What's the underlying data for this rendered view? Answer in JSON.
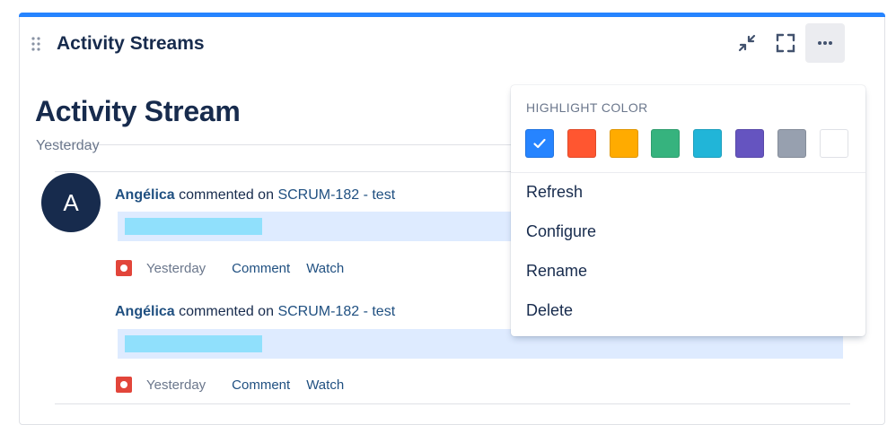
{
  "gadget": {
    "title": "Activity Streams",
    "accent_color": "#2684ff",
    "header_buttons": [
      {
        "name": "minimize",
        "icon": "minimize-icon"
      },
      {
        "name": "maximize",
        "icon": "maximize-icon"
      },
      {
        "name": "more",
        "icon": "more-icon"
      }
    ]
  },
  "stream": {
    "title": "Activity Stream",
    "day_label": "Yesterday",
    "avatar_initial": "A",
    "entries": [
      {
        "user": "Angélica",
        "action": "commented on",
        "issue": "SCRUM-182 - test",
        "time": "Yesterday",
        "comment_label": "Comment",
        "watch_label": "Watch"
      },
      {
        "user": "Angélica",
        "action": "commented on",
        "issue": "SCRUM-182 - test",
        "time": "Yesterday",
        "comment_label": "Comment",
        "watch_label": "Watch"
      }
    ]
  },
  "menu": {
    "heading": "HIGHLIGHT COLOR",
    "colors": [
      {
        "name": "blue",
        "hex": "#2684ff",
        "selected": true
      },
      {
        "name": "red",
        "hex": "#ff5630",
        "selected": false
      },
      {
        "name": "yellow",
        "hex": "#ffab00",
        "selected": false
      },
      {
        "name": "green",
        "hex": "#36b37e",
        "selected": false
      },
      {
        "name": "teal",
        "hex": "#21b5d8",
        "selected": false
      },
      {
        "name": "purple",
        "hex": "#6554c0",
        "selected": false
      },
      {
        "name": "grey",
        "hex": "#97a0af",
        "selected": false
      },
      {
        "name": "white",
        "hex": "#ffffff",
        "selected": false
      }
    ],
    "items": [
      "Refresh",
      "Configure",
      "Rename",
      "Delete"
    ]
  }
}
